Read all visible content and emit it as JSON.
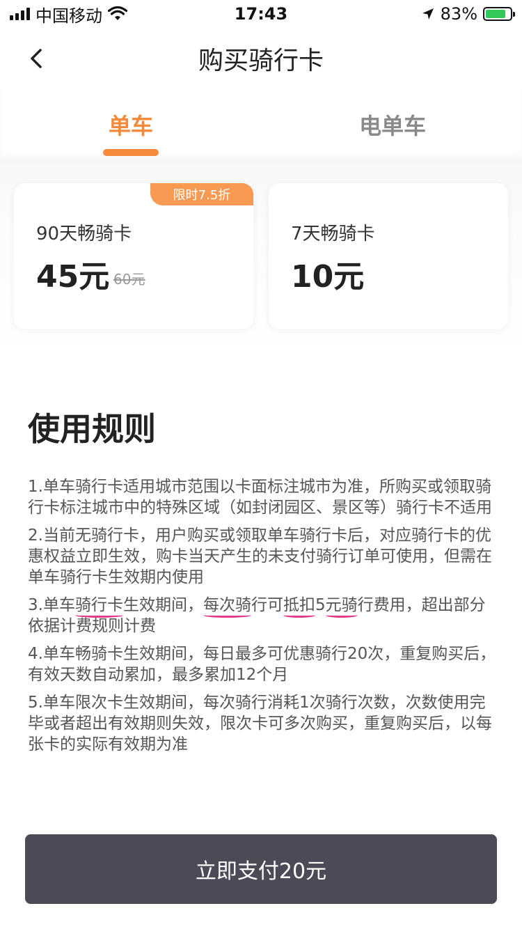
{
  "status_bar": {
    "carrier": "中国移动",
    "time": "17:43",
    "battery": "83%",
    "battery_level": 0.83
  },
  "nav": {
    "title": "购买骑行卡"
  },
  "tabs": [
    {
      "label": "单车",
      "active": true
    },
    {
      "label": "电单车",
      "active": false
    }
  ],
  "cards": [
    {
      "badge": "限时7.5折",
      "name": "90天畅骑卡",
      "price": "45元",
      "original_price": "60元"
    },
    {
      "name": "7天畅骑卡",
      "price": "10元"
    }
  ],
  "rules": {
    "title": "使用规则",
    "items": [
      "1.单车骑行卡适用城市范围以卡面标注城市为准，所购买或领取骑行卡标注城市中的特殊区域（如封闭园区、景区等）骑行卡不适用",
      "2.当前无骑行卡，用户购买或领取单车骑行卡后，对应骑行卡的优惠权益立即生效，购卡当天产生的未支付骑行订单可使用，但需在单车骑行卡生效期内使用",
      "3.单车骑行卡生效期间，每次骑行可抵扣5元骑行费用，超出部分依据计费规则计费",
      "4.单车畅骑卡生效期间，每日最多可优惠骑行20次，重复购买后，有效天数自动累加，最多累加12个月",
      "5.单车限次卡生效期间，每次骑行消耗1次骑行次数，次数使用完毕或者超出有效期则失效，限次卡可多次购买，重复购买后，以每张卡的实际有效期为准"
    ]
  },
  "rule3_parts": [
    "3.单车",
    "骑行卡",
    "生效期间，",
    "每次骑",
    "行可",
    "抵扣",
    "5",
    "元骑",
    "行费用，超出部分依据计费规则计费"
  ],
  "pay_button": {
    "label": "立即支付20元"
  },
  "colors": {
    "accent": "#f58a3b",
    "badge": "#f89a52",
    "pay_button": "#4b4b57",
    "annotation": "#e23a8a"
  }
}
